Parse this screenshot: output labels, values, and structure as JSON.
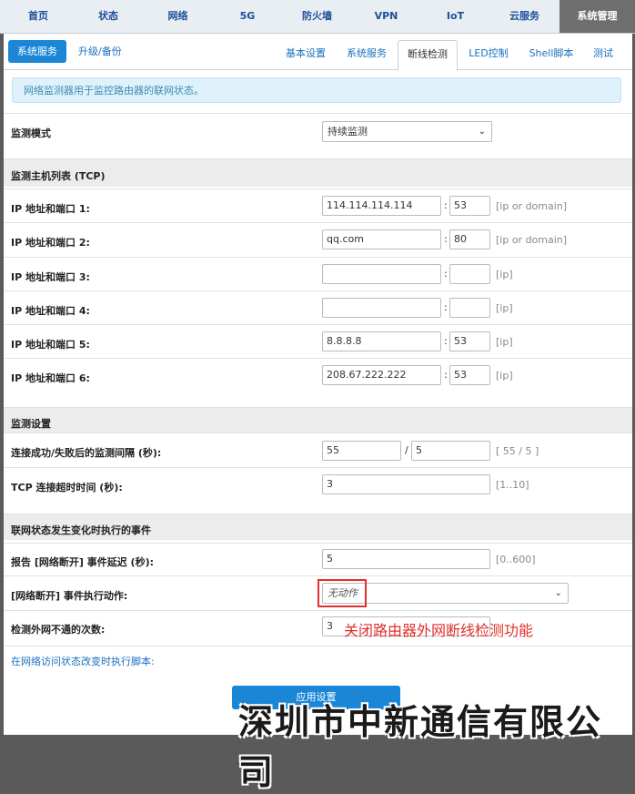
{
  "topnav": [
    "首页",
    "状态",
    "网络",
    "5G",
    "防火墙",
    "VPN",
    "IoT",
    "云服务",
    "系统管理"
  ],
  "subtabs": {
    "left_primary": "系统服务",
    "left_link": "升级/备份",
    "right": [
      "基本设置",
      "系统服务",
      "断线检测",
      "LED控制",
      "Shell脚本",
      "测试"
    ]
  },
  "info": "网络监测器用于监控路由器的联网状态。",
  "mode": {
    "label": "监测模式",
    "value": "持续监测"
  },
  "hosts": {
    "section": "监测主机列表 (TCP)",
    "rows": [
      {
        "label": "IP 地址和端口 1:",
        "ip": "114.114.114.114",
        "port": "53",
        "hint": "[ip or domain]"
      },
      {
        "label": "IP 地址和端口 2:",
        "ip": "qq.com",
        "port": "80",
        "hint": "[ip or domain]"
      },
      {
        "label": "IP 地址和端口 3:",
        "ip": "",
        "port": "",
        "hint": "[ip]"
      },
      {
        "label": "IP 地址和端口 4:",
        "ip": "",
        "port": "",
        "hint": "[ip]"
      },
      {
        "label": "IP 地址和端口 5:",
        "ip": "8.8.8.8",
        "port": "53",
        "hint": "[ip]"
      },
      {
        "label": "IP 地址和端口 6:",
        "ip": "208.67.222.222",
        "port": "53",
        "hint": "[ip]"
      }
    ]
  },
  "monitor": {
    "section": "监测设置",
    "interval": {
      "label": "连接成功/失败后的监测间隔 (秒):",
      "a": "55",
      "b": "5",
      "hint": "[ 55 / 5 ]"
    },
    "timeout": {
      "label": "TCP 连接超时时间 (秒):",
      "value": "3",
      "hint": "[1..10]"
    }
  },
  "events": {
    "section": "联网状态发生变化时执行的事件",
    "delay": {
      "label": "报告 [网络断开] 事件延迟 (秒):",
      "value": "5",
      "hint": "[0..600]"
    },
    "action": {
      "label": "[网络断开] 事件执行动作:",
      "value": "无动作"
    },
    "count": {
      "label": "检测外网不通的次数:",
      "value": "3"
    }
  },
  "annotation": "关闭路由器外网断线检测功能",
  "script_link": "在网络访问状态改变时执行脚本:",
  "apply": "应用设置",
  "watermark": "深圳市中新通信有限公司"
}
